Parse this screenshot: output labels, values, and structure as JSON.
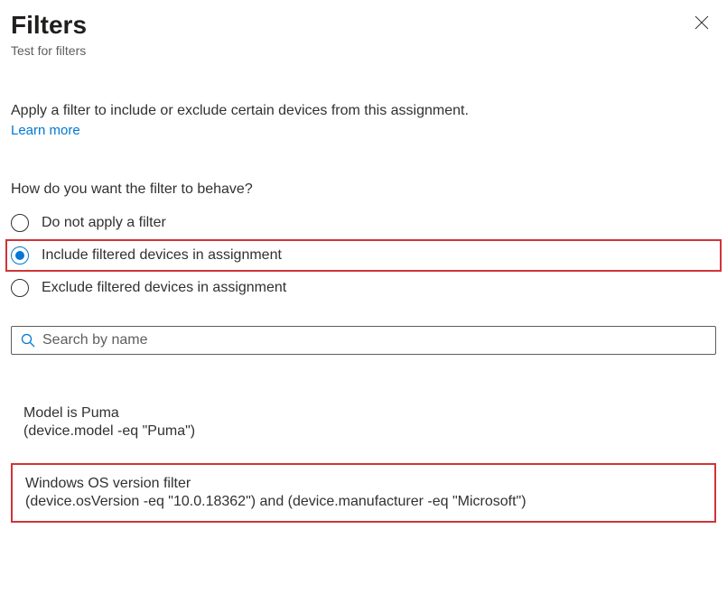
{
  "header": {
    "title": "Filters",
    "subtitle": "Test for filters"
  },
  "body": {
    "description": "Apply a filter to include or exclude certain devices from this assignment.",
    "learn_more": "Learn more",
    "question": "How do you want the filter to behave?"
  },
  "radio_options": {
    "none": "Do not apply a filter",
    "include": "Include filtered devices in assignment",
    "exclude": "Exclude filtered devices in assignment",
    "selected": "include"
  },
  "search": {
    "placeholder": "Search by name",
    "value": ""
  },
  "filters": [
    {
      "name": "Model is Puma",
      "expression": "(device.model -eq \"Puma\")",
      "highlighted": false
    },
    {
      "name": "Windows OS version filter",
      "expression": "(device.osVersion -eq \"10.0.18362\") and (device.manufacturer -eq \"Microsoft\")",
      "highlighted": true
    }
  ]
}
